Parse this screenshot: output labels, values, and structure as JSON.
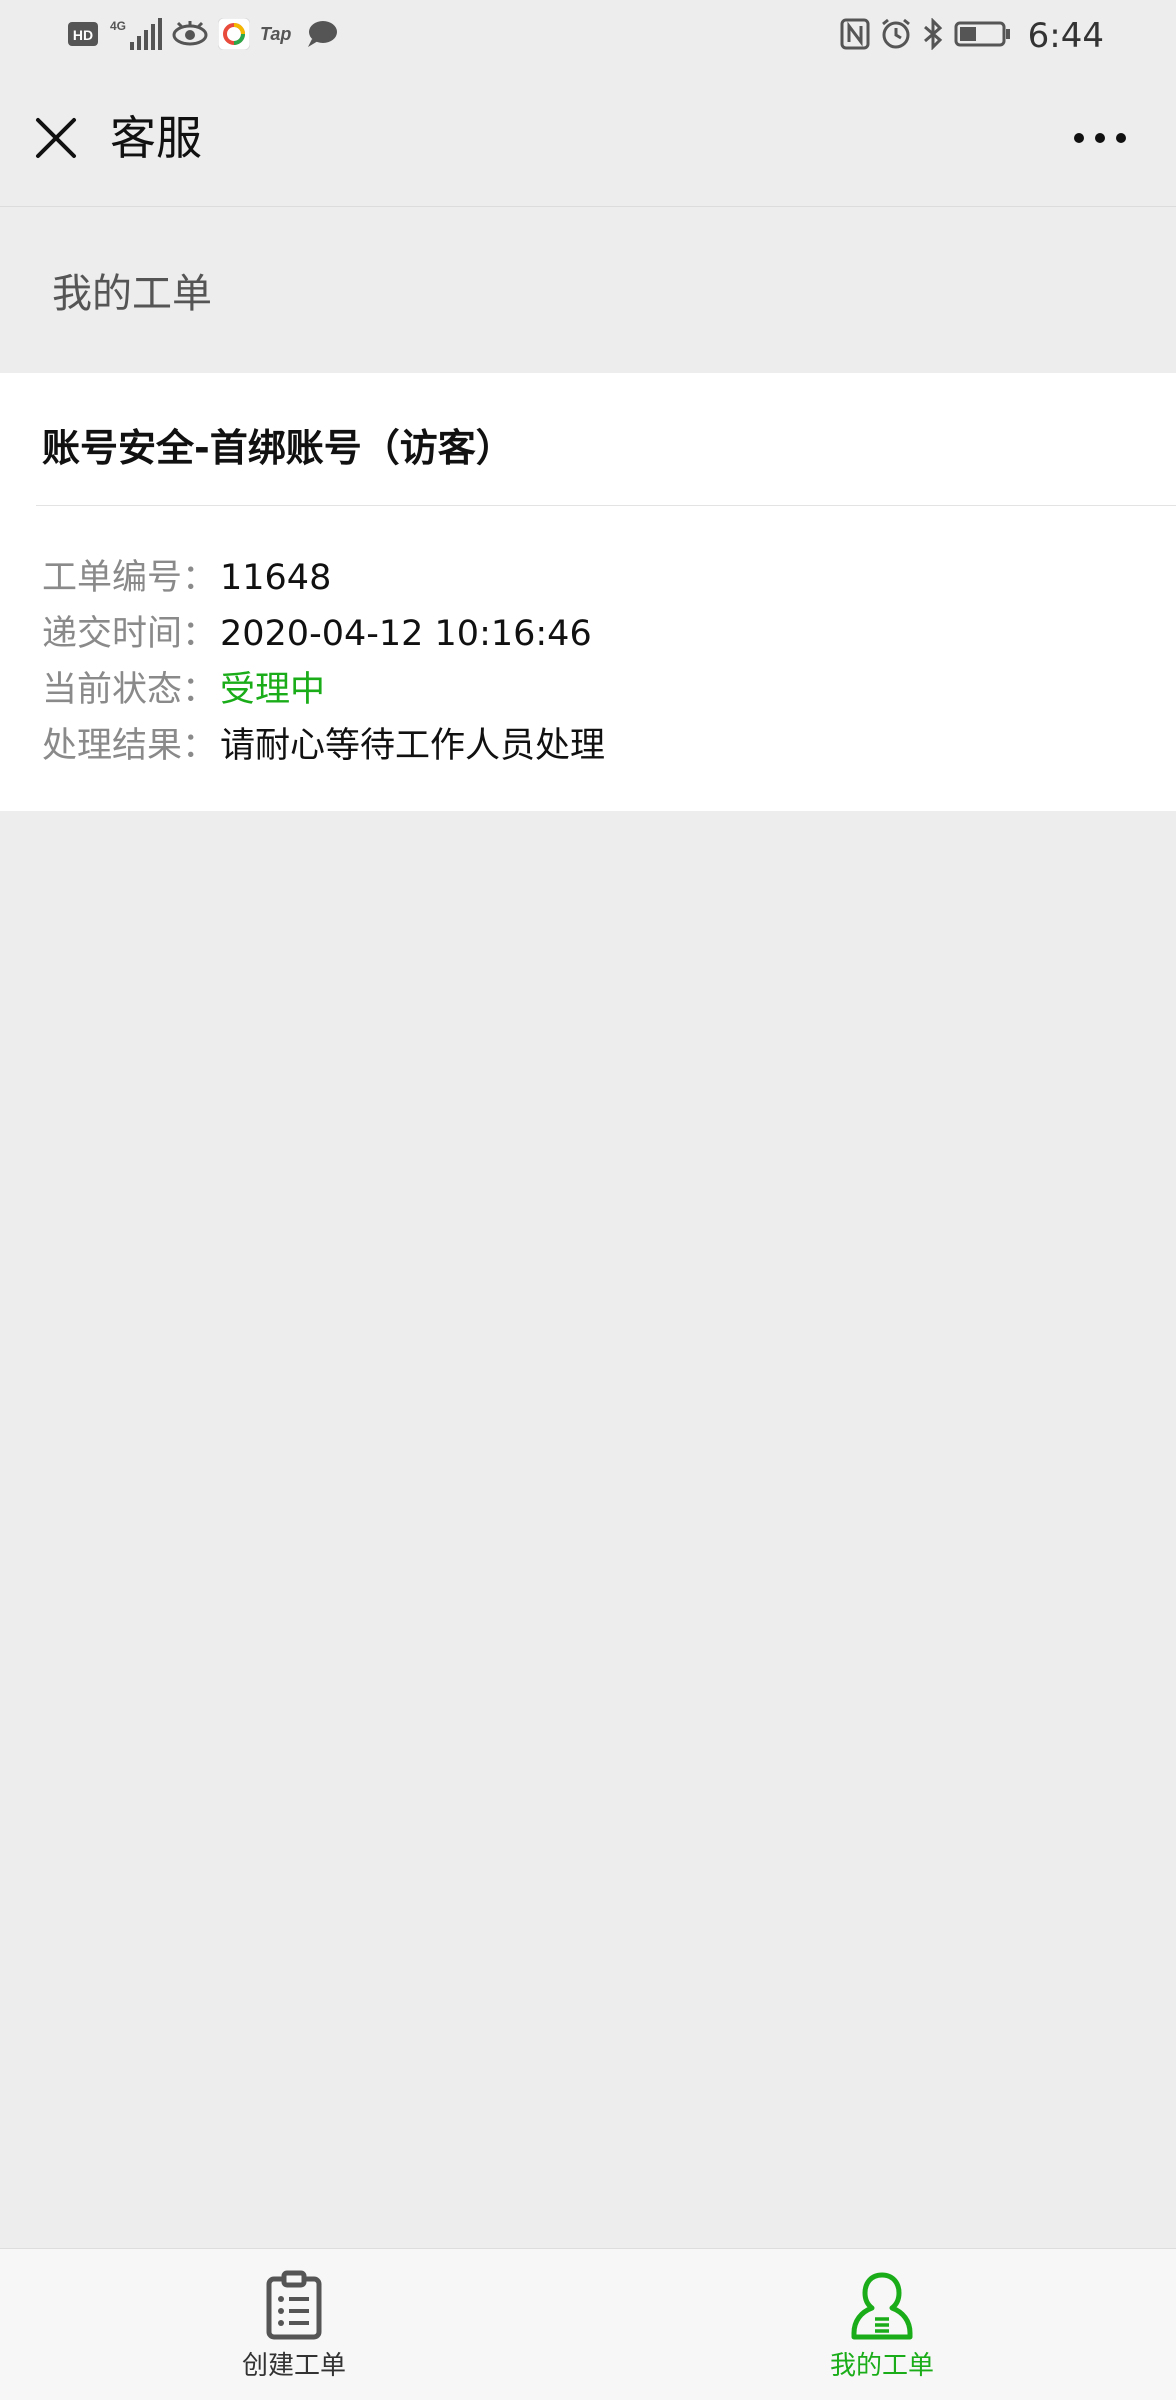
{
  "status_bar": {
    "left_icons": [
      "hd-icon",
      "signal-4g-icon",
      "eye-icon",
      "app-icon",
      "tap-icon",
      "chat-bubble-icon"
    ],
    "hd_label": "HD",
    "network_label": "4G",
    "tap_label": "Tap",
    "right_icons": [
      "nfc-icon",
      "alarm-icon",
      "bluetooth-icon",
      "battery-icon"
    ],
    "time": "6:44"
  },
  "navbar": {
    "title": "客服",
    "close_icon": "close-icon",
    "more_icon": "more-dots-icon"
  },
  "section": {
    "title": "我的工单"
  },
  "ticket": {
    "title": "账号安全-首绑账号（访客）",
    "fields": [
      {
        "label": "工单编号：",
        "value": "11648"
      },
      {
        "label": "递交时间：",
        "value": "2020-04-12 10:16:46"
      },
      {
        "label": "当前状态：",
        "value": "受理中"
      },
      {
        "label": "处理结果：",
        "value": "请耐心等待工作人员处理"
      }
    ]
  },
  "tabbar": {
    "create": {
      "label": "创建工单",
      "icon": "clipboard-list-icon"
    },
    "mine": {
      "label": "我的工单",
      "icon": "user-icon",
      "active": true
    }
  },
  "colors": {
    "accent": "#1aad19",
    "background": "#ededed",
    "card": "#ffffff"
  }
}
